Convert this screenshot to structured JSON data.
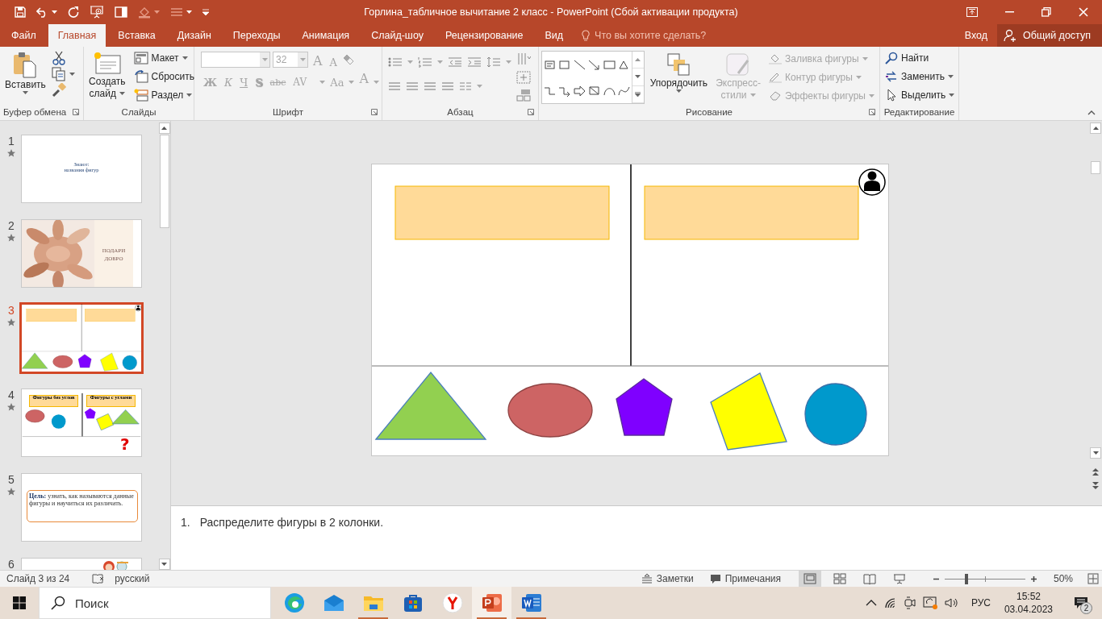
{
  "window": {
    "title": "Горлина_табличное вычитание 2 класс - PowerPoint (Сбой активации продукта)"
  },
  "ribbon_tabs": [
    {
      "label": "Файл",
      "selected": false
    },
    {
      "label": "Главная",
      "selected": true
    },
    {
      "label": "Вставка",
      "selected": false
    },
    {
      "label": "Дизайн",
      "selected": false
    },
    {
      "label": "Переходы",
      "selected": false
    },
    {
      "label": "Анимация",
      "selected": false
    },
    {
      "label": "Слайд-шоу",
      "selected": false
    },
    {
      "label": "Рецензирование",
      "selected": false
    },
    {
      "label": "Вид",
      "selected": false
    }
  ],
  "tell_me": {
    "placeholder": "Что вы хотите сделать?"
  },
  "sign_in": "Вход",
  "share": "Общий доступ",
  "ribbon": {
    "clipboard": {
      "paste": "Вставить",
      "label": "Буфер обмена"
    },
    "slides": {
      "new_slide": [
        "Создать",
        "слайд"
      ],
      "layout": "Макет",
      "reset": "Сбросить",
      "section": "Раздел",
      "label": "Слайды"
    },
    "font": {
      "disabled": true,
      "font_size": "32",
      "size_buttons": [
        "A",
        "A"
      ],
      "buttons": [
        "Ж",
        "К",
        "Ч",
        "S",
        "abc",
        "AV",
        "Aa",
        "A"
      ],
      "label": "Шрифт"
    },
    "paragraph": {
      "label": "Абзац"
    },
    "drawing": {
      "arrange": "Упорядочить",
      "quick_styles": {
        "lines": [
          "Экспресс-",
          "стили"
        ],
        "disabled": true
      },
      "fill": {
        "label": "Заливка фигуры",
        "disabled": true
      },
      "outline": {
        "label": "Контур фигуры",
        "disabled": true
      },
      "effects": {
        "label": "Эффекты фигуры",
        "disabled": true
      },
      "label": "Рисование"
    },
    "editing": {
      "find": "Найти",
      "replace": "Заменить",
      "select": "Выделить",
      "label": "Редактирование"
    }
  },
  "thumbnails": [
    {
      "number": "1",
      "selected": false,
      "animated": true,
      "kind": "title",
      "lines": [
        "Знают:",
        "названия фигур"
      ]
    },
    {
      "number": "2",
      "selected": false,
      "animated": true,
      "lines": [
        "ПОДАРИ",
        "ДОБРО"
      ]
    },
    {
      "number": "3",
      "selected": true,
      "animated": true,
      "kind": "current"
    },
    {
      "number": "4",
      "selected": false,
      "animated": true,
      "kind": "sorted",
      "labels": [
        "Фигуры без углов",
        "Фигуры с углами"
      ],
      "mark": "?"
    },
    {
      "number": "5",
      "selected": false,
      "animated": true,
      "kind": "goal",
      "text": "**Цель:** узнать, как называются данные фигуры и научиться их различать."
    },
    {
      "number": "6",
      "selected": false,
      "kind": "picture"
    }
  ],
  "slide": {
    "shapes": [
      {
        "kind": "triangle",
        "color": "#92d050"
      },
      {
        "kind": "ellipse",
        "color": "#cd6464"
      },
      {
        "kind": "pentagon",
        "color": "#7f00ff"
      },
      {
        "kind": "square",
        "color": "#ffff00"
      },
      {
        "kind": "circle",
        "color": "#0099cc"
      }
    ]
  },
  "notes": {
    "number": "1.",
    "text": "Распределите фигуры в 2 колонки."
  },
  "status_bar": {
    "slide": "Слайд 3 из 24",
    "language": "русский",
    "notes": "Заметки",
    "comments": "Примечания",
    "views": [
      {
        "kind": "normal",
        "selected": true
      },
      {
        "kind": "sorter",
        "selected": false
      },
      {
        "kind": "reading",
        "selected": false
      },
      {
        "kind": "slideshow",
        "selected": false
      }
    ],
    "zoom": {
      "level": 0.25,
      "reading": "50%"
    }
  },
  "taskbar": {
    "search": {
      "placeholder": "Поиск"
    },
    "apps": [
      {
        "kind": "edge",
        "running": false,
        "selected": false
      },
      {
        "kind": "mail",
        "running": false,
        "selected": false
      },
      {
        "kind": "explorer",
        "running": true,
        "selected": false
      },
      {
        "kind": "store",
        "running": false,
        "selected": false
      },
      {
        "kind": "yandex",
        "running": false,
        "selected": false
      },
      {
        "kind": "powerpoint",
        "running": true,
        "selected": true
      },
      {
        "kind": "word",
        "running": true,
        "selected": false
      }
    ],
    "language": "РУС",
    "time": "15:52",
    "date": "03.04.2023",
    "notifications": "2"
  }
}
